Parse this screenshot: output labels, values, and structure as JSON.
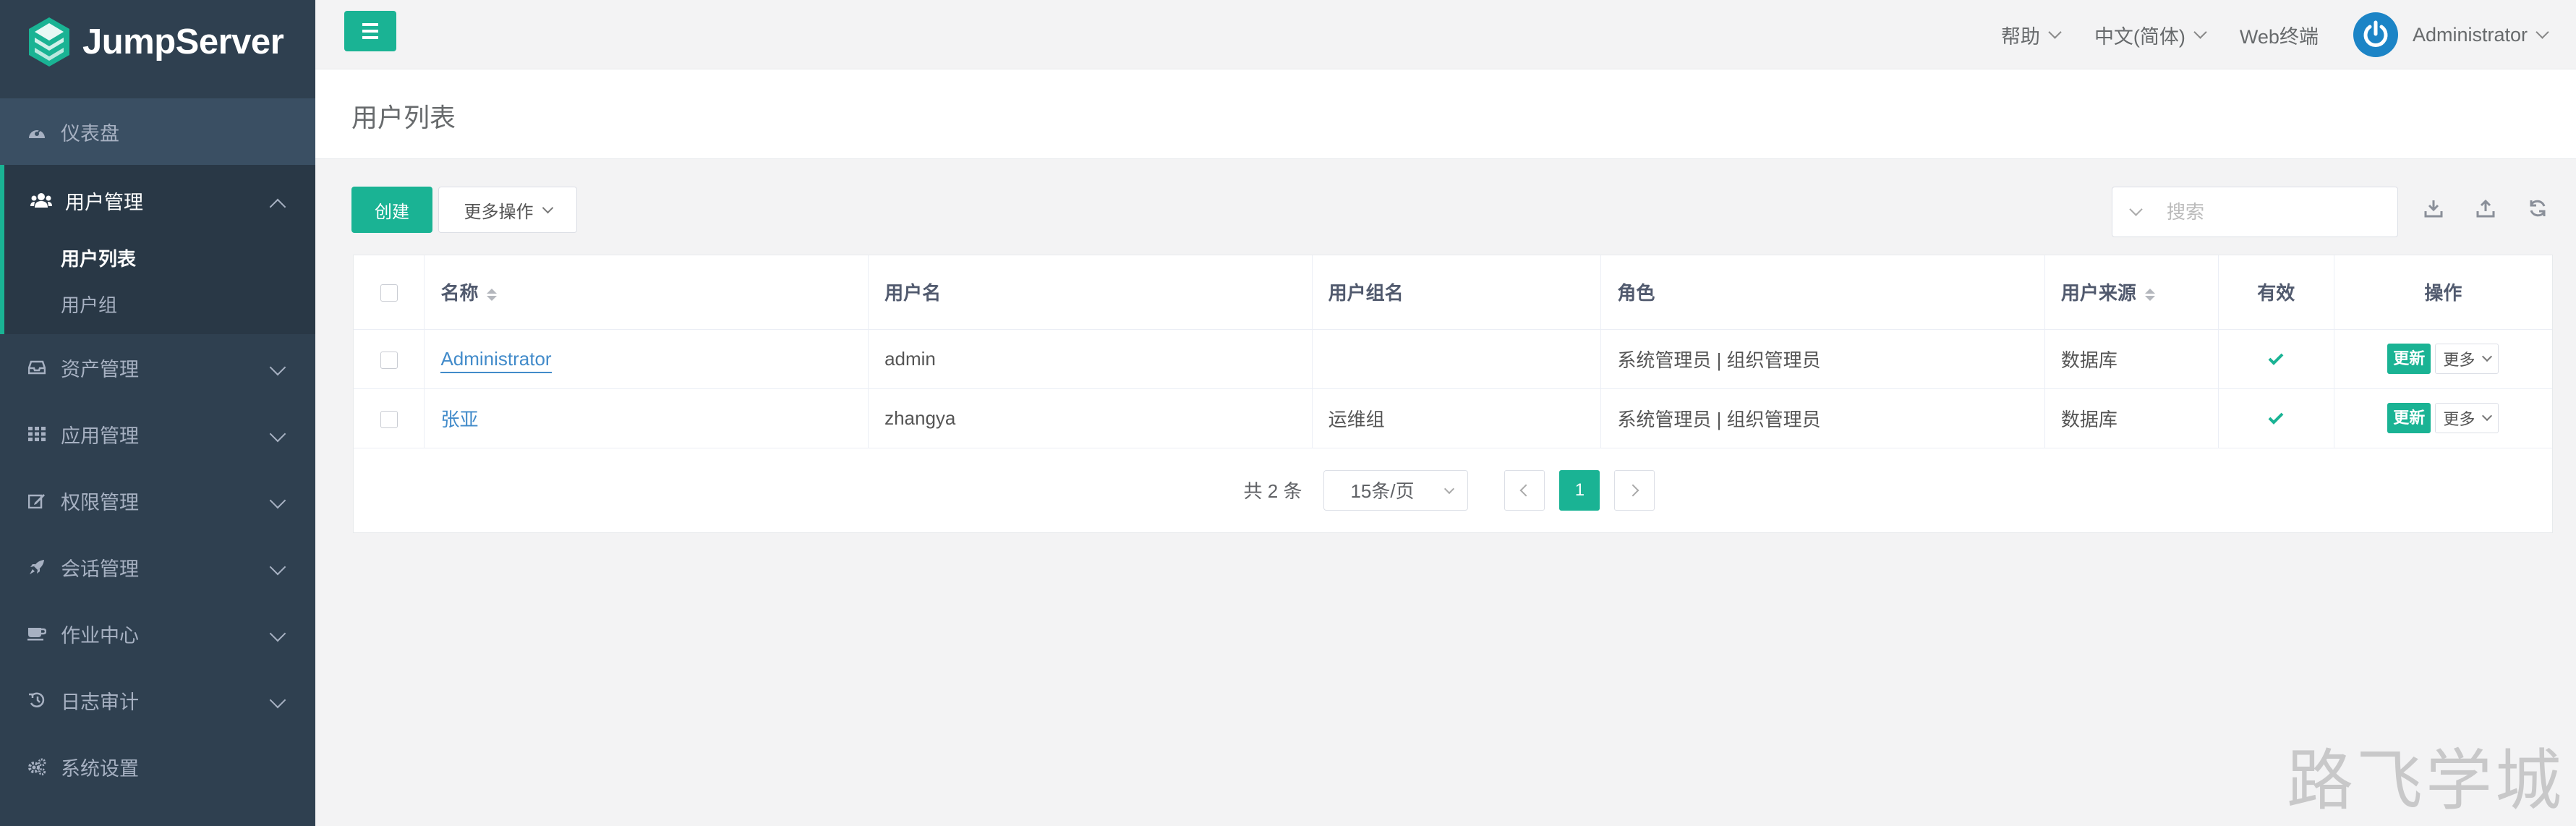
{
  "brand": {
    "name": "JumpServer"
  },
  "sidebar": {
    "items": [
      {
        "label": "仪表盘",
        "icon": "dashboard-icon"
      },
      {
        "label": "用户管理",
        "icon": "users-icon",
        "expanded": true,
        "children": [
          {
            "label": "用户列表",
            "current": true
          },
          {
            "label": "用户组"
          }
        ]
      },
      {
        "label": "资产管理",
        "icon": "inbox-icon"
      },
      {
        "label": "应用管理",
        "icon": "grid-icon"
      },
      {
        "label": "权限管理",
        "icon": "edit-icon"
      },
      {
        "label": "会话管理",
        "icon": "rocket-icon"
      },
      {
        "label": "作业中心",
        "icon": "coffee-icon"
      },
      {
        "label": "日志审计",
        "icon": "history-icon"
      },
      {
        "label": "系统设置",
        "icon": "cogs-icon"
      }
    ]
  },
  "topbar": {
    "help": "帮助",
    "language": "中文(简体)",
    "web_terminal": "Web终端",
    "user": "Administrator"
  },
  "page": {
    "title": "用户列表"
  },
  "toolbar": {
    "create": "创建",
    "more_actions": "更多操作",
    "search_placeholder": "搜索"
  },
  "table": {
    "columns": [
      "名称",
      "用户名",
      "用户组名",
      "角色",
      "用户来源",
      "有效",
      "操作"
    ],
    "rows": [
      {
        "name": "Administrator",
        "username": "admin",
        "group": "",
        "role": "系统管理员 | 组织管理员",
        "source": "数据库",
        "valid": true,
        "update": "更新",
        "more": "更多"
      },
      {
        "name": "张亚",
        "username": "zhangya",
        "group": "运维组",
        "role": "系统管理员 | 组织管理员",
        "source": "数据库",
        "valid": true,
        "update": "更新",
        "more": "更多"
      }
    ]
  },
  "pagination": {
    "total": "共 2 条",
    "page_size": "15条/页",
    "current_page": "1"
  },
  "watermark": "路飞学城",
  "colors": {
    "accent": "#1ab394",
    "sidebar": "#2f4050",
    "link": "#428bca"
  }
}
